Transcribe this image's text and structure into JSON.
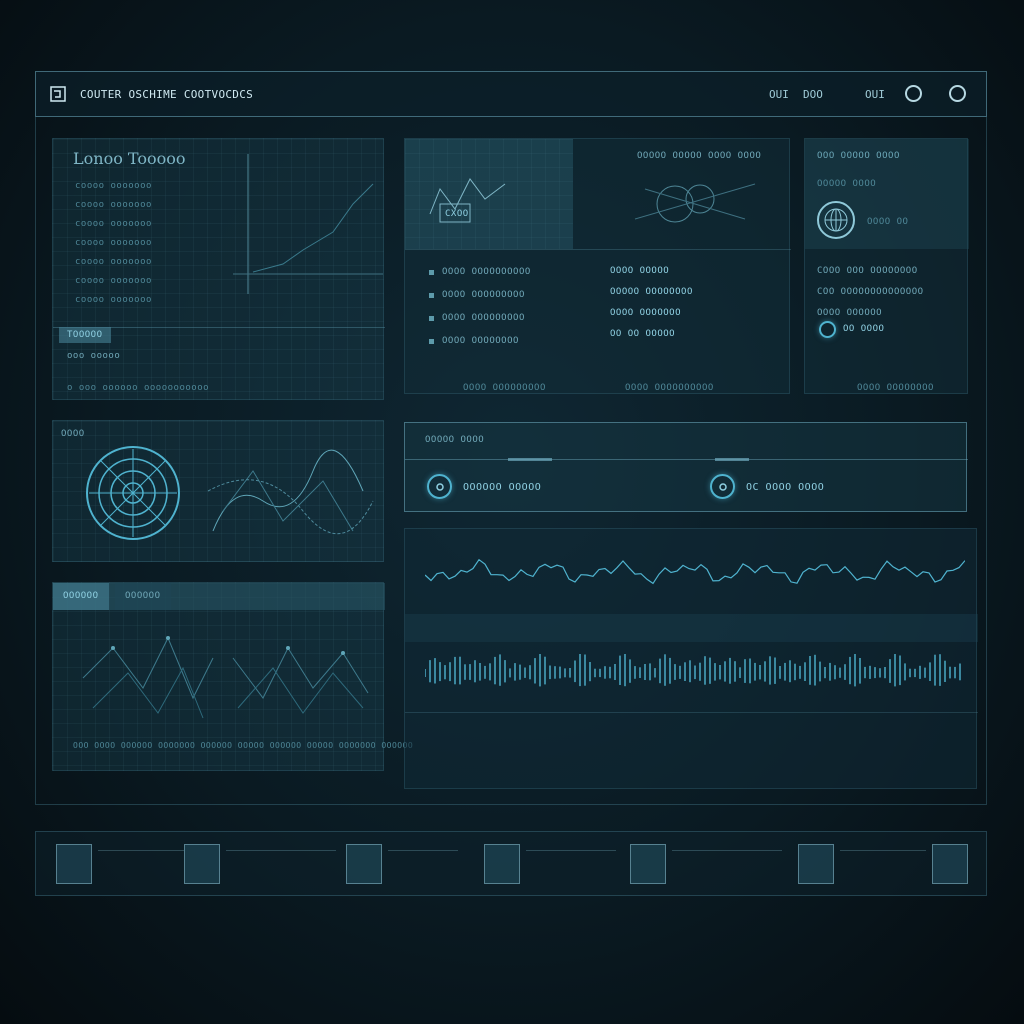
{
  "header": {
    "title": "COUTER OSCHIME COOTVOCDCS",
    "nav": [
      "OUI",
      "DOO",
      "OUI"
    ]
  },
  "panel_a": {
    "title": "Lonoo Tooooo",
    "rows": [
      "coooo ooooooo",
      "coooo ooooooo",
      "coooo ooooooo",
      "coooo ooooooo",
      "coooo ooooooo",
      "coooo ooooooo",
      "coooo ooooooo"
    ],
    "tab": "TOOOOO",
    "subtitle": "ooo ooooo",
    "footer": "o ooo oooooo ooooooooooo"
  },
  "panel_b": {
    "preview_label": "CXOO",
    "header_text": "OOOOO OOOOO OOOO OOOO",
    "list": [
      "OOOO OOOOOOOOOO",
      "OOOO OOOOOOOOO",
      "OOOO OOOOOOOOO",
      "OOOO OOOOOOOO"
    ],
    "details": [
      "OOOO OOOOO",
      "OOOOO OOOOOOOO",
      "OOOO OOOOOOO",
      "OO OO OOOOO"
    ],
    "footer_left": "OOOO OOOOOOOOO",
    "footer_right": "OOOO OOOOOOOOOO"
  },
  "panel_c": {
    "title": "OOO OOOOO OOOO",
    "rows": [
      "OOOOO OOOO",
      "OOOO OO"
    ],
    "lines": [
      "COOO OOO OOOOOOOO",
      "COO OOOOOOOOOOOOOO",
      "OOOO OOOOOO"
    ],
    "badge": "OO OOOO",
    "footer": "OOOO OOOOOOOO"
  },
  "panel_d": {
    "title": "OOOO"
  },
  "panel_e": {
    "tabs": [
      "OOOOOO",
      "OOOOOO"
    ],
    "footer": "OOO OOOO OOOOOO OOOOOOO OOOOOO OOOOO OOOOOO OOOOO OOOOOOO OOOOOO"
  },
  "status_bar": {
    "title": "OOOOO OOOO",
    "items": [
      "OOOOOO OOOOO",
      "OC OOOO OOOO"
    ]
  },
  "dock": {
    "count": 7
  },
  "colors": {
    "accent": "#4fb3cf",
    "background": "#0a1a22",
    "panel": "#193c4a"
  }
}
